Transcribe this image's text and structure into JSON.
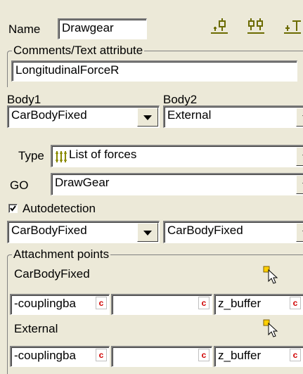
{
  "name": {
    "label": "Name",
    "value": "Drawgear"
  },
  "toolbar": {
    "icons": [
      "add-child-icon",
      "add-sibling-icon",
      "split-icon"
    ]
  },
  "comments": {
    "title": "Comments/Text attribute",
    "value": "LongitudinalForceR"
  },
  "body1": {
    "label": "Body1",
    "value": "CarBodyFixed"
  },
  "body2": {
    "label": "Body2",
    "value": "External"
  },
  "type": {
    "label": "Type",
    "value": "List of forces",
    "icon": "force-list-icon"
  },
  "go": {
    "label": "GO",
    "value": "DrawGear"
  },
  "autodetection": {
    "label": "Autodetection",
    "checked": true
  },
  "couple": {
    "left": "CarBodyFixed",
    "right": "CarBodyFixed"
  },
  "attachment": {
    "title": "Attachment points",
    "points": [
      {
        "label": "CarBodyFixed",
        "values": [
          "-couplingba",
          "",
          "z_buffer"
        ]
      },
      {
        "label": "External",
        "values": [
          "-couplingba",
          "",
          "z_buffer"
        ]
      }
    ],
    "badge": "c"
  }
}
